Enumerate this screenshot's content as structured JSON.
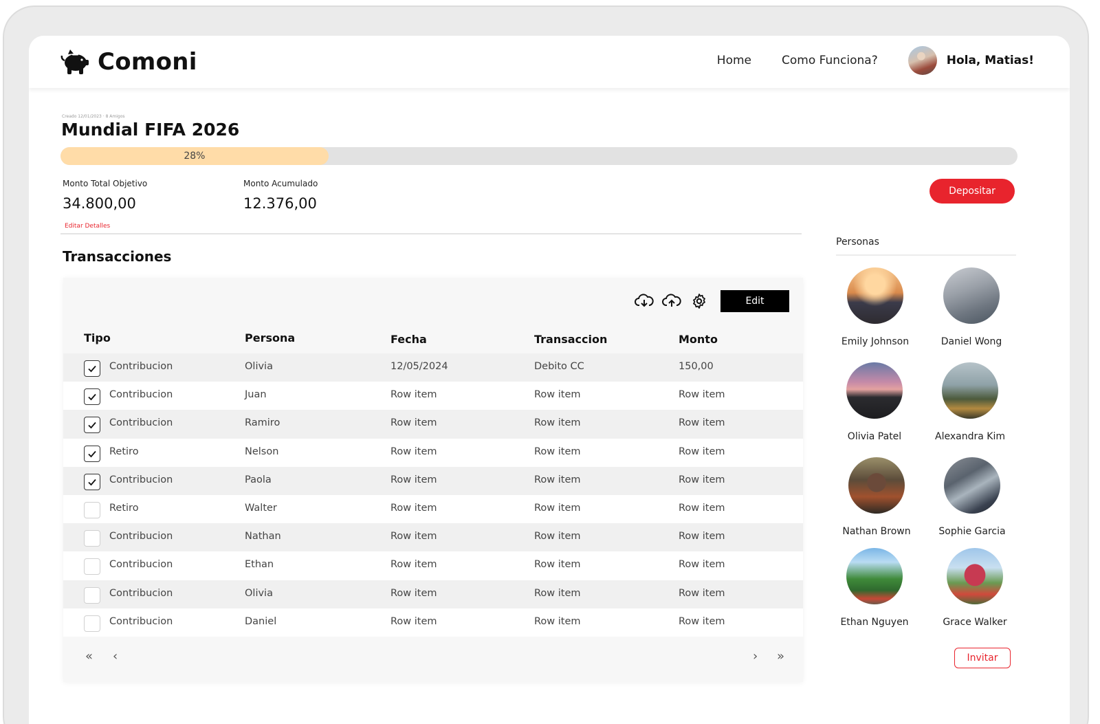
{
  "header": {
    "brand": "Comoni",
    "nav": [
      "Home",
      "Como Funciona?"
    ],
    "greeting": "Hola, Matias!"
  },
  "goal": {
    "meta": "Creado 12/01/2023 · 8 Amigos",
    "title": "Mundial FIFA 2026",
    "progress_percent": 28,
    "progress_label": "28%",
    "target_label": "Monto Total Objetivo",
    "target_value": "34.800,00",
    "accumulated_label": "Monto Acumulado",
    "accumulated_value": "12.376,00",
    "edit_label": "Editar Detalles",
    "deposit_label": "Depositar"
  },
  "transactions": {
    "title": "Transacciones",
    "edit_label": "Edit",
    "columns": [
      "Tipo",
      "Persona",
      "Fecha",
      "Transaccion",
      "Monto"
    ],
    "rows": [
      {
        "checked": true,
        "tipo": "Contribucion",
        "persona": "Olivia",
        "fecha": "12/05/2024",
        "transaccion": "Debito CC",
        "monto": "150,00"
      },
      {
        "checked": true,
        "tipo": "Contribucion",
        "persona": "Juan",
        "fecha": "Row item",
        "transaccion": "Row item",
        "monto": "Row item"
      },
      {
        "checked": true,
        "tipo": "Contribucion",
        "persona": "Ramiro",
        "fecha": "Row item",
        "transaccion": "Row item",
        "monto": "Row item"
      },
      {
        "checked": true,
        "tipo": "Retiro",
        "persona": "Nelson",
        "fecha": "Row item",
        "transaccion": "Row item",
        "monto": "Row item"
      },
      {
        "checked": true,
        "tipo": "Contribucion",
        "persona": "Paola",
        "fecha": "Row item",
        "transaccion": "Row item",
        "monto": "Row item"
      },
      {
        "checked": false,
        "tipo": "Retiro",
        "persona": "Walter",
        "fecha": "Row item",
        "transaccion": "Row item",
        "monto": "Row item"
      },
      {
        "checked": false,
        "tipo": "Contribucion",
        "persona": "Nathan",
        "fecha": "Row item",
        "transaccion": "Row item",
        "monto": "Row item"
      },
      {
        "checked": false,
        "tipo": "Contribucion",
        "persona": "Ethan",
        "fecha": "Row item",
        "transaccion": "Row item",
        "monto": "Row item"
      },
      {
        "checked": false,
        "tipo": "Contribucion",
        "persona": "Olivia",
        "fecha": "Row item",
        "transaccion": "Row item",
        "monto": "Row item"
      },
      {
        "checked": false,
        "tipo": "Contribucion",
        "persona": "Daniel",
        "fecha": "Row item",
        "transaccion": "Row item",
        "monto": "Row item"
      }
    ],
    "pager": {
      "first": "«",
      "prev": "‹",
      "next": "›",
      "last": "»"
    }
  },
  "personas": {
    "title": "Personas",
    "people": [
      {
        "name": "Emily Johnson"
      },
      {
        "name": "Daniel Wong"
      },
      {
        "name": "Olivia Patel"
      },
      {
        "name": "Alexandra Kim"
      },
      {
        "name": "Nathan Brown"
      },
      {
        "name": "Sophie Garcia"
      },
      {
        "name": "Ethan Nguyen"
      },
      {
        "name": "Grace Walker"
      }
    ],
    "invite_label": "Invitar"
  },
  "colors": {
    "accent": "#e8242d",
    "progress_fill": "#ffdca8",
    "progress_track": "#e2e2e2"
  },
  "icons": [
    "piggy-bank-icon",
    "cloud-download-icon",
    "cloud-upload-icon",
    "gear-icon",
    "check-icon",
    "double-chevron-left-icon",
    "chevron-left-icon",
    "chevron-right-icon",
    "double-chevron-right-icon"
  ]
}
